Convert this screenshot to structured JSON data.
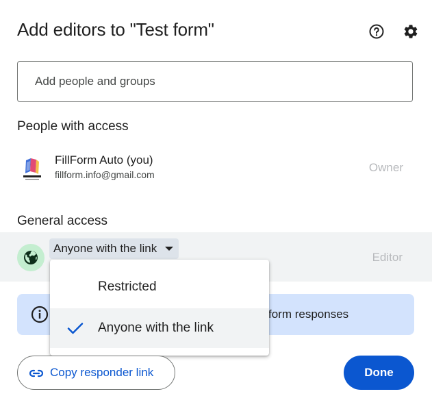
{
  "dialog": {
    "title": "Add editors to \"Test form\"",
    "icons": {
      "help": "help-circle-icon",
      "settings": "gear-icon"
    }
  },
  "add_people": {
    "placeholder": "Add people and groups",
    "value": ""
  },
  "people_with_access": {
    "heading": "People with access",
    "people": [
      {
        "name": "FillForm Auto (you)",
        "email": "fillform.info@gmail.com",
        "role": "Owner",
        "avatar": "FILL FORM"
      }
    ]
  },
  "general_access": {
    "heading": "General access",
    "selected": "Anyone with the link",
    "role": "Editor",
    "icon": "globe-icon",
    "options": [
      {
        "label": "Restricted",
        "checked": false
      },
      {
        "label": "Anyone with the link",
        "checked": true
      }
    ]
  },
  "info_banner": {
    "text": "form responses",
    "icon": "info-icon"
  },
  "footer": {
    "copy_label": "Copy responder link",
    "copy_icon": "link-icon",
    "done_label": "Done"
  },
  "colors": {
    "primary": "#0b57d0",
    "globe_bg": "#c4eed0",
    "banner_bg": "#d3e3fd",
    "row_bg": "#f1f3f4"
  }
}
